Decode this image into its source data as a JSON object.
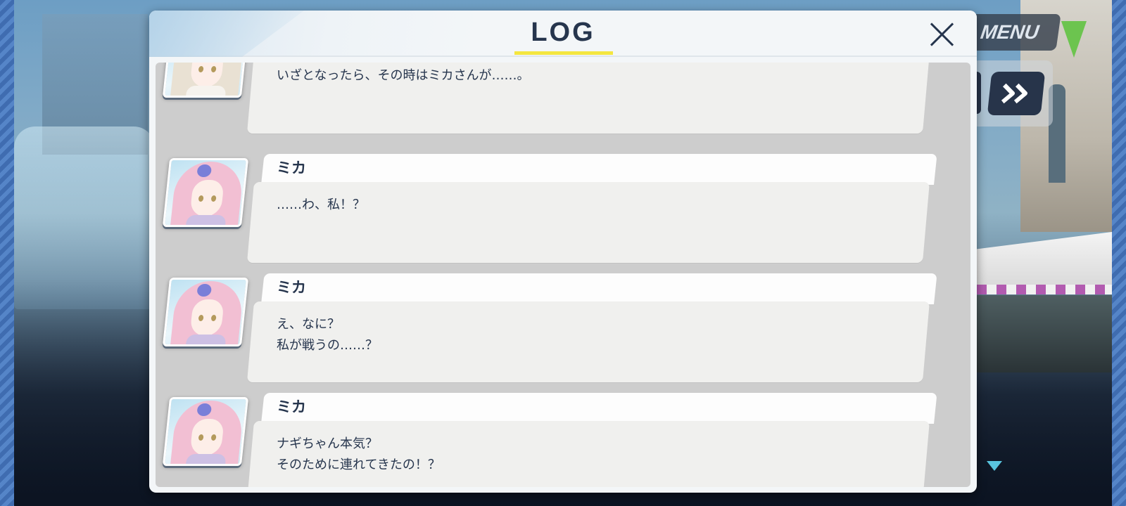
{
  "log": {
    "title": "LOG",
    "entries": [
      {
        "speaker": "",
        "character": "nagisa",
        "lines": "いざとなったら、その時はミカさんが……。"
      },
      {
        "speaker": "ミカ",
        "character": "mika",
        "lines": "……わ、私！？"
      },
      {
        "speaker": "ミカ",
        "character": "mika",
        "lines": "え、なに？\n私が戦うの……？"
      },
      {
        "speaker": "ミカ",
        "character": "mika",
        "lines": "ナギちゃん本気？\nそのために連れてきたの！？"
      }
    ]
  },
  "hud": {
    "menu_label": "MENU",
    "fastforward_icon": "fast-forward-icon",
    "next_icon": "next-triangle-icon"
  },
  "colors": {
    "title_text": "#26354d",
    "title_underline": "#f4e640",
    "modal_bg": "#f3f6f8",
    "list_bg": "#cdcdcd",
    "bubble_bg": "#f0f0ee",
    "hud_button": "#27344a"
  }
}
